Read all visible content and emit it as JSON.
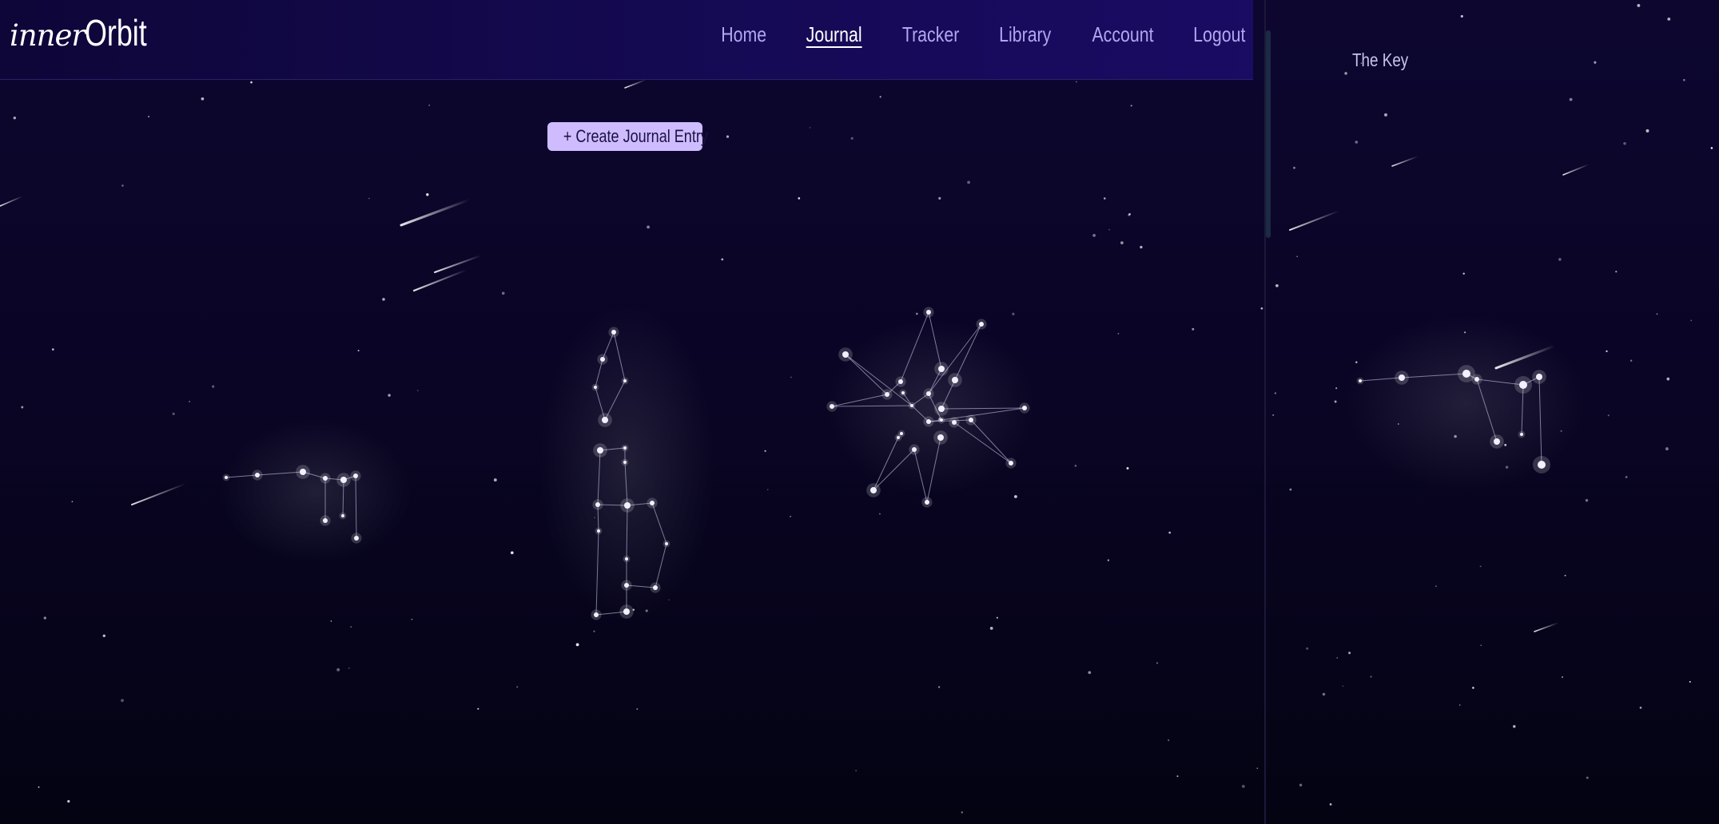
{
  "logo": {
    "script_part": "inner",
    "word_part": "Orbit"
  },
  "nav": {
    "items": [
      {
        "label": "Home",
        "active": false
      },
      {
        "label": "Journal",
        "active": true
      },
      {
        "label": "Tracker",
        "active": false
      },
      {
        "label": "Library",
        "active": false
      },
      {
        "label": "Account",
        "active": false
      },
      {
        "label": "Logout",
        "active": false
      }
    ]
  },
  "journal": {
    "create_button_label": "+ Create Journal Entry"
  },
  "key_panel": {
    "title": "The Key"
  },
  "colors": {
    "nav_text": "#b2a6ef",
    "nav_active": "#ffffff",
    "button_bg": "#cfbcff",
    "star": "#ffffff"
  }
}
